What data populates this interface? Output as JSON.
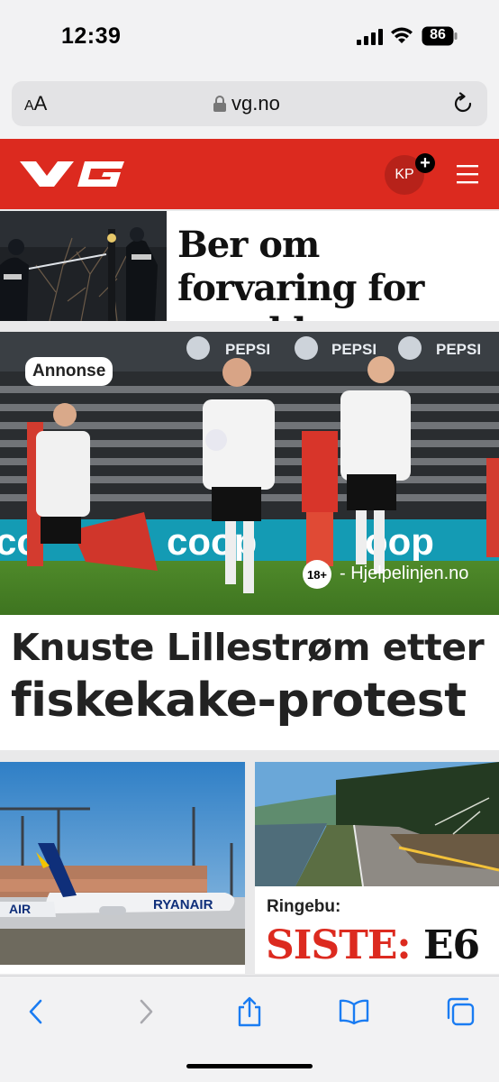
{
  "status_bar": {
    "time": "12:39",
    "battery": "86",
    "icons": [
      "cellular-signal-icon",
      "wifi-icon",
      "battery-icon"
    ]
  },
  "browser": {
    "aa_label_small": "A",
    "aa_label_large": "A",
    "url": "vg.no",
    "icons": [
      "lock-icon",
      "reload-icon"
    ]
  },
  "header": {
    "avatar_initials": "KP",
    "plus_badge": "+",
    "brand_color": "#dc2a1f",
    "icons": [
      "vg-logo",
      "hamburger-menu-icon"
    ]
  },
  "stories": [
    {
      "title": "Ber om forvaring for sverddrap"
    },
    {
      "badge": "Annonse",
      "age_badge": "18+",
      "helpline": "- Hjelpelinjen.no",
      "title_line1": "Knuste Lillestrøm etter",
      "title_line2": "fiskekake-protest"
    },
    {
      "image": "airport-plane-photo"
    },
    {
      "kicker": "Ringebu:",
      "title_highlight": "SISTE:",
      "title_rest": "E6"
    }
  ],
  "toolbar": {
    "icons": [
      "back-chevron-icon",
      "forward-chevron-icon",
      "share-icon",
      "bookmarks-icon",
      "tabs-icon"
    ]
  }
}
